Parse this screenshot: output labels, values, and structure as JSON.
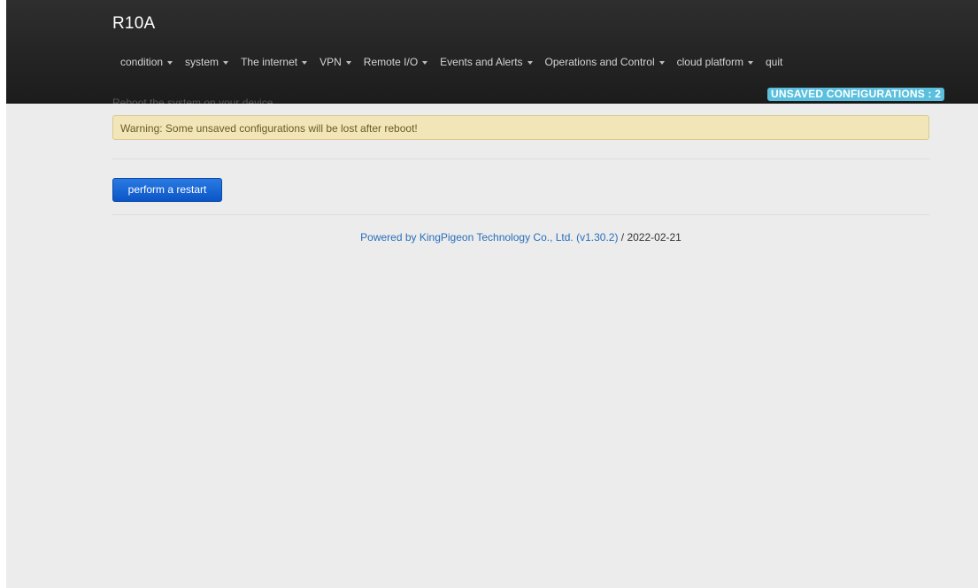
{
  "app": {
    "title": "R10A"
  },
  "nav": {
    "items": [
      {
        "label": "condition",
        "dropdown": true
      },
      {
        "label": "system",
        "dropdown": true
      },
      {
        "label": "The internet",
        "dropdown": true
      },
      {
        "label": "VPN",
        "dropdown": true
      },
      {
        "label": "Remote I/O",
        "dropdown": true
      },
      {
        "label": "Events and Alerts",
        "dropdown": true
      },
      {
        "label": "Operations and Control",
        "dropdown": true
      },
      {
        "label": "cloud platform",
        "dropdown": true
      },
      {
        "label": "quit",
        "dropdown": false
      }
    ],
    "unsaved_badge": "UNSAVED CONFIGURATIONS : 2"
  },
  "main": {
    "description": "Reboot the system on your device",
    "warning": "Warning: Some unsaved configurations will be lost after reboot!",
    "restart_button": "perform a restart"
  },
  "footer": {
    "link_text": "Powered by KingPigeon Technology Co., Ltd. (v1.30.2)",
    "date_text": " / 2022-02-21"
  },
  "colors": {
    "navbar": "#222222",
    "badge": "#5bc0de",
    "warning_bg": "#f2e6b8",
    "button": "#1565d8",
    "link": "#2a6fba"
  }
}
